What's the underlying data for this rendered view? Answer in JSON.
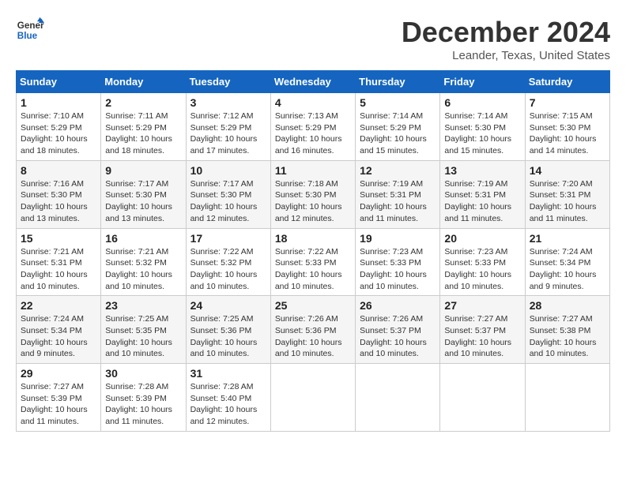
{
  "logo": {
    "line1": "General",
    "line2": "Blue"
  },
  "header": {
    "month": "December 2024",
    "location": "Leander, Texas, United States"
  },
  "weekdays": [
    "Sunday",
    "Monday",
    "Tuesday",
    "Wednesday",
    "Thursday",
    "Friday",
    "Saturday"
  ],
  "weeks": [
    [
      {
        "day": "1",
        "sunrise": "Sunrise: 7:10 AM",
        "sunset": "Sunset: 5:29 PM",
        "daylight": "Daylight: 10 hours and 18 minutes."
      },
      {
        "day": "2",
        "sunrise": "Sunrise: 7:11 AM",
        "sunset": "Sunset: 5:29 PM",
        "daylight": "Daylight: 10 hours and 18 minutes."
      },
      {
        "day": "3",
        "sunrise": "Sunrise: 7:12 AM",
        "sunset": "Sunset: 5:29 PM",
        "daylight": "Daylight: 10 hours and 17 minutes."
      },
      {
        "day": "4",
        "sunrise": "Sunrise: 7:13 AM",
        "sunset": "Sunset: 5:29 PM",
        "daylight": "Daylight: 10 hours and 16 minutes."
      },
      {
        "day": "5",
        "sunrise": "Sunrise: 7:14 AM",
        "sunset": "Sunset: 5:29 PM",
        "daylight": "Daylight: 10 hours and 15 minutes."
      },
      {
        "day": "6",
        "sunrise": "Sunrise: 7:14 AM",
        "sunset": "Sunset: 5:30 PM",
        "daylight": "Daylight: 10 hours and 15 minutes."
      },
      {
        "day": "7",
        "sunrise": "Sunrise: 7:15 AM",
        "sunset": "Sunset: 5:30 PM",
        "daylight": "Daylight: 10 hours and 14 minutes."
      }
    ],
    [
      {
        "day": "8",
        "sunrise": "Sunrise: 7:16 AM",
        "sunset": "Sunset: 5:30 PM",
        "daylight": "Daylight: 10 hours and 13 minutes."
      },
      {
        "day": "9",
        "sunrise": "Sunrise: 7:17 AM",
        "sunset": "Sunset: 5:30 PM",
        "daylight": "Daylight: 10 hours and 13 minutes."
      },
      {
        "day": "10",
        "sunrise": "Sunrise: 7:17 AM",
        "sunset": "Sunset: 5:30 PM",
        "daylight": "Daylight: 10 hours and 12 minutes."
      },
      {
        "day": "11",
        "sunrise": "Sunrise: 7:18 AM",
        "sunset": "Sunset: 5:30 PM",
        "daylight": "Daylight: 10 hours and 12 minutes."
      },
      {
        "day": "12",
        "sunrise": "Sunrise: 7:19 AM",
        "sunset": "Sunset: 5:31 PM",
        "daylight": "Daylight: 10 hours and 11 minutes."
      },
      {
        "day": "13",
        "sunrise": "Sunrise: 7:19 AM",
        "sunset": "Sunset: 5:31 PM",
        "daylight": "Daylight: 10 hours and 11 minutes."
      },
      {
        "day": "14",
        "sunrise": "Sunrise: 7:20 AM",
        "sunset": "Sunset: 5:31 PM",
        "daylight": "Daylight: 10 hours and 11 minutes."
      }
    ],
    [
      {
        "day": "15",
        "sunrise": "Sunrise: 7:21 AM",
        "sunset": "Sunset: 5:31 PM",
        "daylight": "Daylight: 10 hours and 10 minutes."
      },
      {
        "day": "16",
        "sunrise": "Sunrise: 7:21 AM",
        "sunset": "Sunset: 5:32 PM",
        "daylight": "Daylight: 10 hours and 10 minutes."
      },
      {
        "day": "17",
        "sunrise": "Sunrise: 7:22 AM",
        "sunset": "Sunset: 5:32 PM",
        "daylight": "Daylight: 10 hours and 10 minutes."
      },
      {
        "day": "18",
        "sunrise": "Sunrise: 7:22 AM",
        "sunset": "Sunset: 5:33 PM",
        "daylight": "Daylight: 10 hours and 10 minutes."
      },
      {
        "day": "19",
        "sunrise": "Sunrise: 7:23 AM",
        "sunset": "Sunset: 5:33 PM",
        "daylight": "Daylight: 10 hours and 10 minutes."
      },
      {
        "day": "20",
        "sunrise": "Sunrise: 7:23 AM",
        "sunset": "Sunset: 5:33 PM",
        "daylight": "Daylight: 10 hours and 10 minutes."
      },
      {
        "day": "21",
        "sunrise": "Sunrise: 7:24 AM",
        "sunset": "Sunset: 5:34 PM",
        "daylight": "Daylight: 10 hours and 9 minutes."
      }
    ],
    [
      {
        "day": "22",
        "sunrise": "Sunrise: 7:24 AM",
        "sunset": "Sunset: 5:34 PM",
        "daylight": "Daylight: 10 hours and 9 minutes."
      },
      {
        "day": "23",
        "sunrise": "Sunrise: 7:25 AM",
        "sunset": "Sunset: 5:35 PM",
        "daylight": "Daylight: 10 hours and 10 minutes."
      },
      {
        "day": "24",
        "sunrise": "Sunrise: 7:25 AM",
        "sunset": "Sunset: 5:36 PM",
        "daylight": "Daylight: 10 hours and 10 minutes."
      },
      {
        "day": "25",
        "sunrise": "Sunrise: 7:26 AM",
        "sunset": "Sunset: 5:36 PM",
        "daylight": "Daylight: 10 hours and 10 minutes."
      },
      {
        "day": "26",
        "sunrise": "Sunrise: 7:26 AM",
        "sunset": "Sunset: 5:37 PM",
        "daylight": "Daylight: 10 hours and 10 minutes."
      },
      {
        "day": "27",
        "sunrise": "Sunrise: 7:27 AM",
        "sunset": "Sunset: 5:37 PM",
        "daylight": "Daylight: 10 hours and 10 minutes."
      },
      {
        "day": "28",
        "sunrise": "Sunrise: 7:27 AM",
        "sunset": "Sunset: 5:38 PM",
        "daylight": "Daylight: 10 hours and 10 minutes."
      }
    ],
    [
      {
        "day": "29",
        "sunrise": "Sunrise: 7:27 AM",
        "sunset": "Sunset: 5:39 PM",
        "daylight": "Daylight: 10 hours and 11 minutes."
      },
      {
        "day": "30",
        "sunrise": "Sunrise: 7:28 AM",
        "sunset": "Sunset: 5:39 PM",
        "daylight": "Daylight: 10 hours and 11 minutes."
      },
      {
        "day": "31",
        "sunrise": "Sunrise: 7:28 AM",
        "sunset": "Sunset: 5:40 PM",
        "daylight": "Daylight: 10 hours and 12 minutes."
      },
      null,
      null,
      null,
      null
    ]
  ]
}
